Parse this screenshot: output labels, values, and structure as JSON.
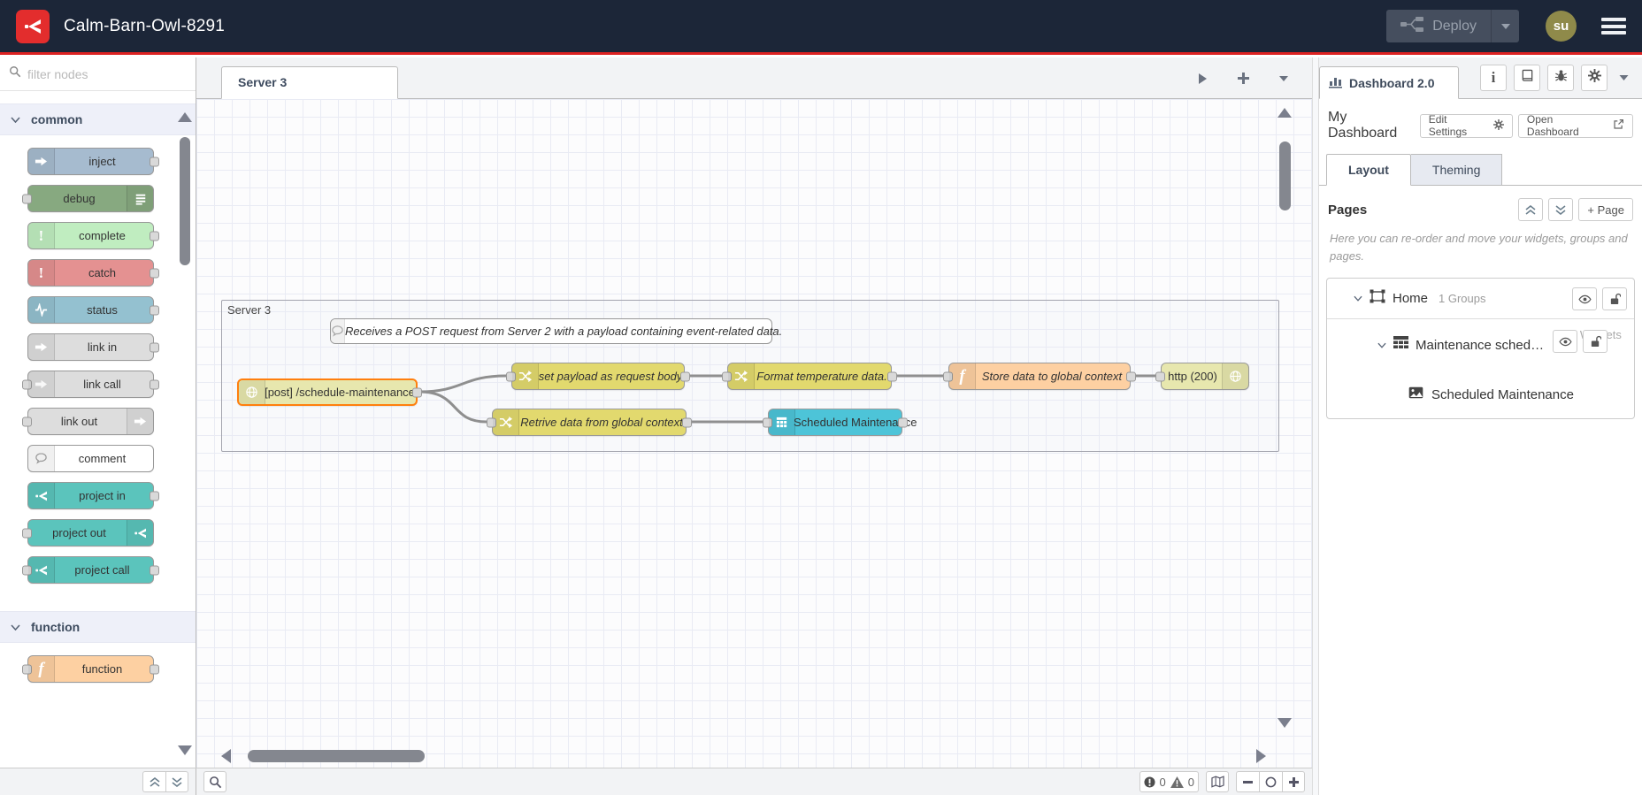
{
  "header": {
    "title": "Calm-Barn-Owl-8291",
    "deploy_label": "Deploy",
    "avatar_text": "su"
  },
  "palette": {
    "filter_placeholder": "filter nodes",
    "categories": [
      {
        "label": "common",
        "nodes": [
          {
            "label": "inject"
          },
          {
            "label": "debug"
          },
          {
            "label": "complete"
          },
          {
            "label": "catch"
          },
          {
            "label": "status"
          },
          {
            "label": "link in"
          },
          {
            "label": "link call"
          },
          {
            "label": "link out"
          },
          {
            "label": "comment"
          },
          {
            "label": "project in"
          },
          {
            "label": "project out"
          },
          {
            "label": "project call"
          }
        ]
      },
      {
        "label": "function",
        "nodes": [
          {
            "label": "function"
          }
        ]
      }
    ]
  },
  "workspace": {
    "tab_label": "Server 3",
    "group_label": "Server 3",
    "comment": "Receives a POST request from Server 2 with a payload containing event-related data.",
    "nodes": [
      {
        "label": "[post] /schedule-maintenance",
        "type": "http in"
      },
      {
        "label": "set payload as request body",
        "type": "change"
      },
      {
        "label": "Format temperature data.",
        "type": "change"
      },
      {
        "label": "Store data to global context",
        "type": "function"
      },
      {
        "label": "http (200)",
        "type": "http response"
      },
      {
        "label": "Retrive data from global context",
        "type": "change"
      },
      {
        "label": "Scheduled Maintenance",
        "type": "ui-table"
      }
    ]
  },
  "sidebar": {
    "tab_label": "Dashboard 2.0",
    "title": "My Dashboard",
    "edit_settings_label": "Edit Settings",
    "open_dashboard_label": "Open Dashboard",
    "tabs": [
      {
        "label": "Layout"
      },
      {
        "label": "Theming"
      }
    ],
    "pages_heading": "Pages",
    "add_page_label": "+ Page",
    "help_text": "Here you can re-order and move your widgets, groups and pages.",
    "tree": {
      "page": {
        "label": "Home",
        "meta": "1 Groups"
      },
      "group": {
        "label": "Maintenance schedul...",
        "meta": "1 Widgets"
      },
      "widget": {
        "label": "Scheduled Maintenance"
      }
    }
  },
  "footer": {
    "errors": "0",
    "warnings": "0"
  },
  "colors": {
    "header_bg": "#1c2638",
    "brand_red": "#dd2222",
    "selection_orange": "#ff7f0e",
    "wire": "#8f8f8f",
    "node_http": "#e7e7ae",
    "node_change": "#e2d96e",
    "node_function": "#fdd0a2",
    "node_table_widget": "#4dc4d8",
    "node_inject": "#a6bbcf",
    "node_debug": "#87a980",
    "node_complete": "#c0edc0",
    "node_catch": "#e49191",
    "node_status": "#94c1d0",
    "node_link": "#dddddd",
    "node_project": "#5bc4bc",
    "avatar_bg": "#8f8a4a"
  },
  "icons": {
    "logo": "flowfuse-mark",
    "deploy": "mini-flow",
    "menu": "hamburger",
    "search": "magnifier",
    "sidebar_buttons": [
      "info",
      "book",
      "bug",
      "gear"
    ],
    "tree": [
      "page-frame",
      "table-grid",
      "image"
    ],
    "row_buttons": [
      "eye",
      "unlock"
    ],
    "footer": [
      "error-circle",
      "warning-triangle",
      "map",
      "zoom-out",
      "zoom-reset",
      "zoom-in"
    ]
  }
}
